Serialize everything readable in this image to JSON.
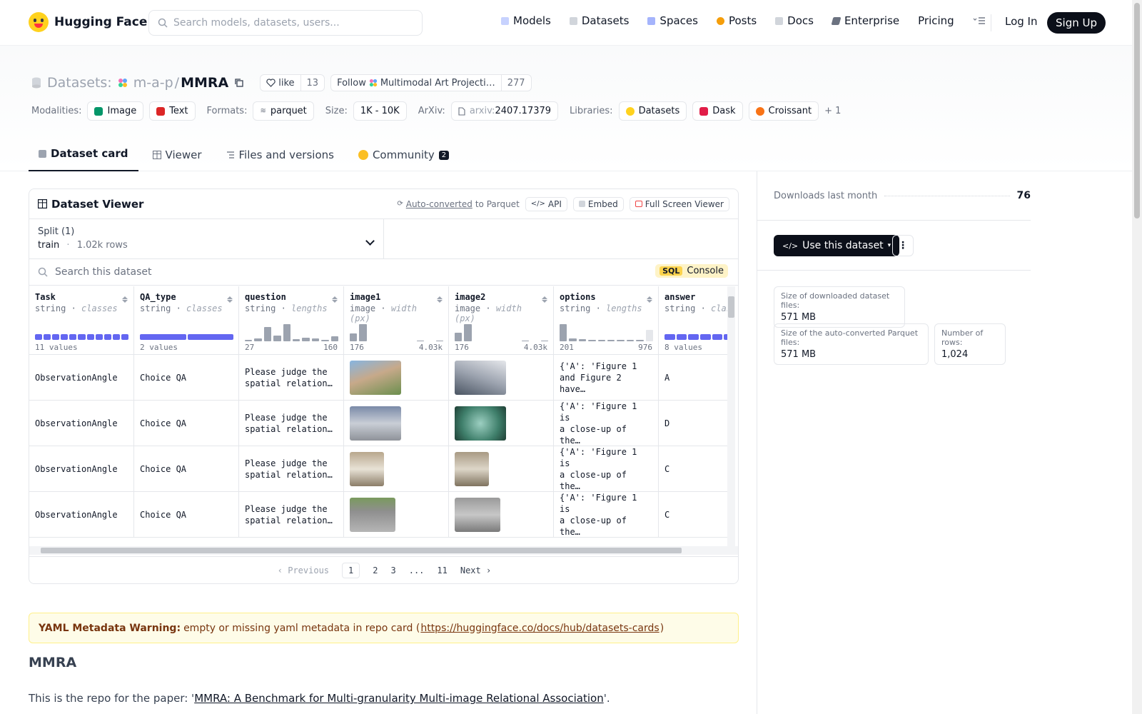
{
  "nav": {
    "brand": "Hugging Face",
    "search_placeholder": "Search models, datasets, users...",
    "links": [
      "Models",
      "Datasets",
      "Spaces",
      "Posts",
      "Docs",
      "Enterprise",
      "Pricing"
    ],
    "login": "Log In",
    "signup": "Sign Up"
  },
  "header": {
    "section": "Datasets:",
    "org": "m-a-p",
    "slash": "/",
    "repo": "MMRA",
    "like_label": "like",
    "like_count": "13",
    "follow_label": "Follow",
    "follow_org": "Multimodal Art Projecti…",
    "follow_count": "277"
  },
  "meta": {
    "modalities_label": "Modalities:",
    "modalities": [
      "Image",
      "Text"
    ],
    "formats_label": "Formats:",
    "format": "parquet",
    "size_label": "Size:",
    "size": "1K - 10K",
    "arxiv_label": "ArXiv:",
    "arxiv_prefix": "arxiv:",
    "arxiv_id": "2407.17379",
    "libraries_label": "Libraries:",
    "libraries": [
      "Datasets",
      "Dask",
      "Croissant"
    ],
    "more_libraries": "+ 1"
  },
  "tabs": [
    "Dataset card",
    "Viewer",
    "Files and versions",
    "Community"
  ],
  "community_count": "2",
  "viewer": {
    "title": "Dataset Viewer",
    "auto_converted": "Auto-converted",
    "to_parquet": "to Parquet",
    "api": "API",
    "embed": "Embed",
    "fullscreen": "Full Screen Viewer",
    "split_label": "Split (1)",
    "split_name": "train",
    "split_dot": "·",
    "split_rows": "1.02k rows",
    "search_placeholder": "Search this dataset",
    "sql_badge": "SQL",
    "sql_label": "Console",
    "columns": [
      {
        "name": "Task",
        "type": "string",
        "stat": "classes",
        "foot_left": "11 values",
        "foot_right": ""
      },
      {
        "name": "QA_type",
        "type": "string",
        "stat": "classes",
        "foot_left": "2 values",
        "foot_right": ""
      },
      {
        "name": "question",
        "type": "string",
        "stat": "lengths",
        "foot_left": "27",
        "foot_right": "160"
      },
      {
        "name": "image1",
        "type": "image",
        "stat": "width (px)",
        "foot_left": "176",
        "foot_right": "4.03k"
      },
      {
        "name": "image2",
        "type": "image",
        "stat": "width (px)",
        "foot_left": "176",
        "foot_right": "4.03k"
      },
      {
        "name": "options",
        "type": "string",
        "stat": "lengths",
        "foot_left": "201",
        "foot_right": "976"
      },
      {
        "name": "answer",
        "type": "string",
        "stat": "classes",
        "foot_left": "8 values",
        "foot_right": ""
      }
    ],
    "rows": [
      {
        "task": "ObservationAngle",
        "qa": "Choice QA",
        "question": "Please judge the\nspatial relation…",
        "options": "{'A': 'Figure 1\nand Figure 2 have…",
        "answer": "A"
      },
      {
        "task": "ObservationAngle",
        "qa": "Choice QA",
        "question": "Please judge the\nspatial relation…",
        "options": "{'A': 'Figure 1 is\na close-up of the…",
        "answer": "D"
      },
      {
        "task": "ObservationAngle",
        "qa": "Choice QA",
        "question": "Please judge the\nspatial relation…",
        "options": "{'A': 'Figure 1 is\na close-up of the…",
        "answer": "C"
      },
      {
        "task": "ObservationAngle",
        "qa": "Choice QA",
        "question": "Please judge the\nspatial relation…",
        "options": "{'A': 'Figure 1 is\na close-up of the…",
        "answer": "C"
      }
    ],
    "pager": {
      "prev": "Previous",
      "pages": [
        "1",
        "2",
        "3",
        "...",
        "11"
      ],
      "next": "Next",
      "current": "1"
    }
  },
  "sidebar": {
    "downloads_label": "Downloads last month",
    "downloads": "76",
    "use_button": "Use this dataset",
    "stats": [
      {
        "label": "Size of downloaded dataset files:",
        "value": "571 MB"
      },
      {
        "label": "Size of the auto-converted Parquet files:",
        "value": "571 MB"
      },
      {
        "label": "Number of rows:",
        "value": "1,024"
      }
    ]
  },
  "card": {
    "warning_title": "YAML Metadata Warning:",
    "warning_text": "empty or missing yaml metadata in repo card (",
    "warning_link": "https://huggingface.co/docs/hub/datasets-cards",
    "warning_close": ")",
    "heading": "MMRA",
    "intro_prefix": "This is the repo for the paper: '",
    "intro_link": "MMRA: A Benchmark for Multi-granularity Multi-image Relational Association",
    "intro_suffix": "'."
  },
  "colors": {
    "accent": "#6366f1",
    "dark": "#0b0f19",
    "warning_bg": "#fefce8"
  }
}
